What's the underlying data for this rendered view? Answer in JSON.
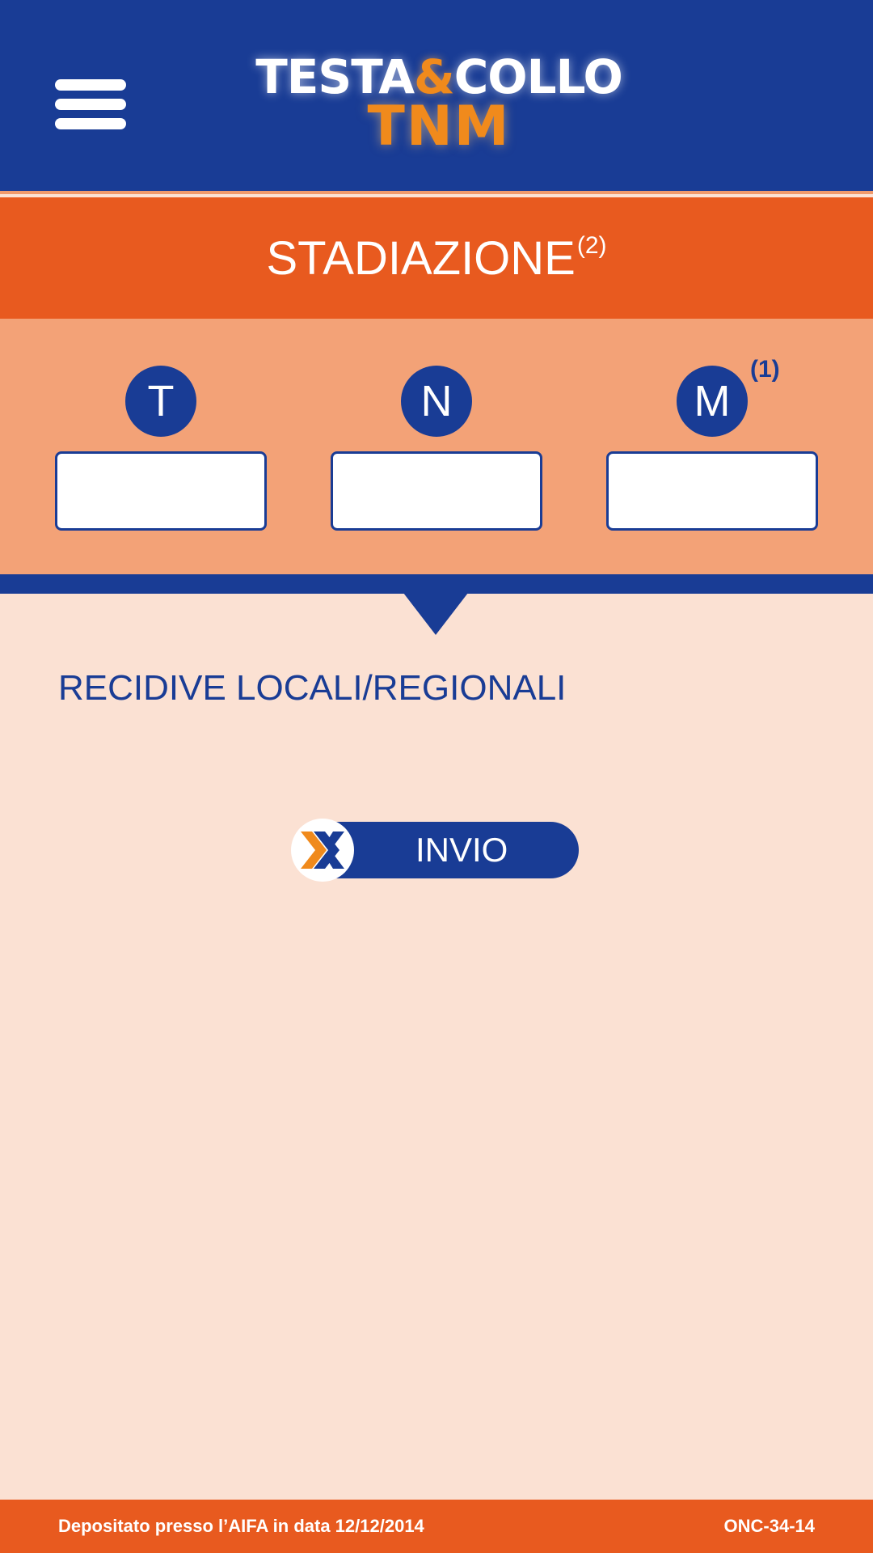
{
  "header": {
    "logo_line1_a": "TESTA",
    "logo_line1_amp": "&",
    "logo_line1_b": "COLLO",
    "logo_line2": "TNM",
    "menu_icon": "hamburger-menu-icon"
  },
  "title_band": {
    "title": "STADIAZIONE",
    "title_sup": "(2)"
  },
  "tnm": {
    "t": {
      "label": "T",
      "value": ""
    },
    "n": {
      "label": "N",
      "value": ""
    },
    "m": {
      "label": "M",
      "note": "(1)",
      "value": ""
    }
  },
  "section": {
    "heading": "RECIDIVE LOCALI/REGIONALI"
  },
  "send_button": {
    "label": "INVIO",
    "icon": "x-arrows-icon"
  },
  "footer": {
    "left_text": "Depositato presso l’AIFA in data 12/12/2014",
    "right_text": "ONC-34-14"
  },
  "colors": {
    "primary_blue": "#193c95",
    "accent_orange": "#e85a1f",
    "band_peach": "#f3a277",
    "background": "#fbe1d3",
    "logo_orange": "#f08a1c"
  }
}
